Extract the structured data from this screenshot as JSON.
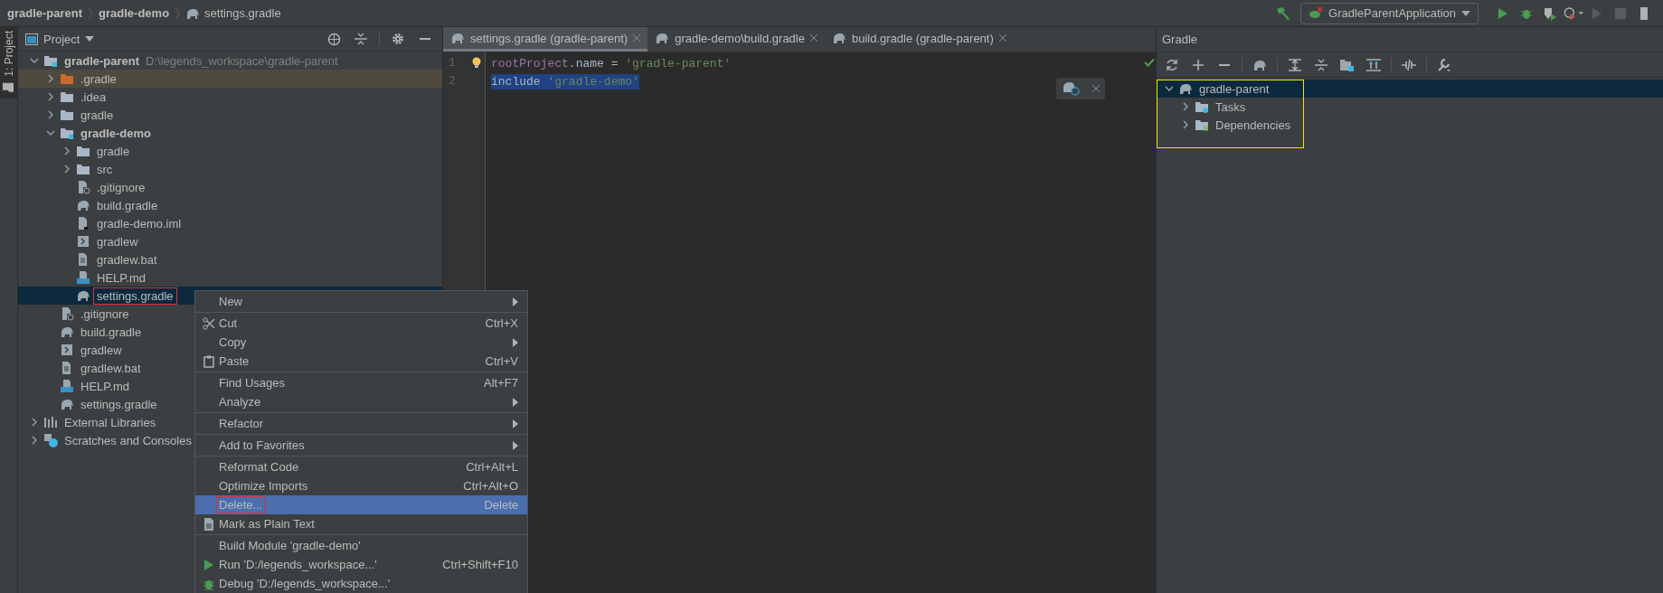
{
  "breadcrumbs": [
    {
      "label": "gradle-parent",
      "kind": "module"
    },
    {
      "label": "gradle-demo",
      "kind": "module"
    },
    {
      "label": "settings.gradle",
      "kind": "gradle"
    }
  ],
  "run_configuration": {
    "label": "GradleParentApplication"
  },
  "side_stripe": {
    "label": "1: Project",
    "selected": true
  },
  "project_panel": {
    "title": "Project",
    "tree": [
      {
        "label": "gradle-parent",
        "path": "D:\\legends_workspace\\gradle-parent",
        "kind": "module",
        "expanded": true,
        "selected": false,
        "marked": false,
        "children": [
          {
            "label": ".gradle",
            "kind": "excluded-folder",
            "expanded": false,
            "selected": false,
            "marked": false
          },
          {
            "label": ".idea",
            "kind": "folder",
            "expanded": false,
            "selected": false,
            "marked": false
          },
          {
            "label": "gradle",
            "kind": "folder",
            "expanded": false,
            "selected": false,
            "marked": false
          },
          {
            "label": "gradle-demo",
            "kind": "module",
            "expanded": true,
            "selected": false,
            "marked": false,
            "children": [
              {
                "label": "gradle",
                "kind": "folder",
                "expanded": false,
                "selected": false,
                "marked": false
              },
              {
                "label": "src",
                "kind": "folder",
                "expanded": false,
                "selected": false,
                "marked": false
              },
              {
                "label": ".gitignore",
                "kind": "ignore",
                "selected": false,
                "marked": false
              },
              {
                "label": "build.gradle",
                "kind": "gradle",
                "selected": false,
                "marked": false
              },
              {
                "label": "gradle-demo.iml",
                "kind": "iml",
                "selected": false,
                "marked": false
              },
              {
                "label": "gradlew",
                "kind": "shell",
                "selected": false,
                "marked": false
              },
              {
                "label": "gradlew.bat",
                "kind": "text",
                "selected": false,
                "marked": false
              },
              {
                "label": "HELP.md",
                "kind": "markdown",
                "selected": false,
                "marked": false
              },
              {
                "label": "settings.gradle",
                "kind": "gradle",
                "selected": true,
                "marked": true
              }
            ]
          },
          {
            "label": ".gitignore",
            "kind": "ignore",
            "selected": false,
            "marked": false
          },
          {
            "label": "build.gradle",
            "kind": "gradle",
            "selected": false,
            "marked": false
          },
          {
            "label": "gradlew",
            "kind": "shell",
            "selected": false,
            "marked": false
          },
          {
            "label": "gradlew.bat",
            "kind": "text",
            "selected": false,
            "marked": false
          },
          {
            "label": "HELP.md",
            "kind": "markdown",
            "selected": false,
            "marked": false
          },
          {
            "label": "settings.gradle",
            "kind": "gradle",
            "selected": false,
            "marked": false
          }
        ]
      },
      {
        "label": "External Libraries",
        "kind": "libraries",
        "expanded": false,
        "selected": false,
        "marked": false
      },
      {
        "label": "Scratches and Consoles",
        "kind": "scratches",
        "expanded": false,
        "selected": false,
        "marked": false
      }
    ]
  },
  "editor": {
    "tabs": [
      {
        "label": "settings.gradle (gradle-parent)",
        "selected": true
      },
      {
        "label": "gradle-demo\\build.gradle",
        "selected": false
      },
      {
        "label": "build.gradle (gradle-parent)",
        "selected": false
      }
    ],
    "lines": [
      {
        "number": "1",
        "selected": false,
        "tokens": [
          {
            "text": "rootProject",
            "kind": "ident"
          },
          {
            "text": ".name = ",
            "kind": "plain"
          },
          {
            "text": "'gradle-parent'",
            "kind": "string"
          }
        ]
      },
      {
        "number": "2",
        "selected": true,
        "tokens": [
          {
            "text": "include ",
            "kind": "plain"
          },
          {
            "text": "'gradle-demo'",
            "kind": "string"
          }
        ]
      }
    ]
  },
  "context_menu": {
    "groups": [
      [
        {
          "label": "New",
          "kind": "plain",
          "submenu": true,
          "selected": false,
          "marked": false
        }
      ],
      [
        {
          "label": "Cut",
          "kind": "cut",
          "shortcut": "Ctrl+X",
          "submenu": false,
          "selected": false,
          "marked": false
        },
        {
          "label": "Copy",
          "kind": "plain",
          "submenu": true,
          "selected": false,
          "marked": false
        },
        {
          "label": "Paste",
          "kind": "paste",
          "shortcut": "Ctrl+V",
          "submenu": false,
          "selected": false,
          "marked": false
        }
      ],
      [
        {
          "label": "Find Usages",
          "kind": "plain",
          "shortcut": "Alt+F7",
          "submenu": false,
          "selected": false,
          "marked": false
        },
        {
          "label": "Analyze",
          "kind": "plain",
          "submenu": true,
          "selected": false,
          "marked": false
        }
      ],
      [
        {
          "label": "Refactor",
          "kind": "plain",
          "submenu": true,
          "selected": false,
          "marked": false
        }
      ],
      [
        {
          "label": "Add to Favorites",
          "kind": "plain",
          "submenu": true,
          "selected": false,
          "marked": false
        }
      ],
      [
        {
          "label": "Reformat Code",
          "kind": "plain",
          "shortcut": "Ctrl+Alt+L",
          "submenu": false,
          "selected": false,
          "marked": false
        },
        {
          "label": "Optimize Imports",
          "kind": "plain",
          "shortcut": "Ctrl+Alt+O",
          "submenu": false,
          "selected": false,
          "marked": false
        },
        {
          "label": "Delete...",
          "kind": "plain",
          "shortcut": "Delete",
          "submenu": false,
          "selected": true,
          "marked": true
        },
        {
          "label": "Mark as Plain Text",
          "kind": "mark",
          "submenu": false,
          "selected": false,
          "marked": false
        }
      ],
      [
        {
          "label": "Build Module 'gradle-demo'",
          "kind": "plain",
          "submenu": false,
          "selected": false,
          "marked": false
        },
        {
          "label": "Run 'D:/legends_workspace...'",
          "kind": "run",
          "shortcut": "Ctrl+Shift+F10",
          "submenu": false,
          "selected": false,
          "marked": false
        },
        {
          "label": "Debug 'D:/legends_workspace...'",
          "kind": "debug",
          "submenu": false,
          "selected": false,
          "marked": false
        }
      ]
    ]
  },
  "gradle_panel": {
    "title": "Gradle",
    "marked": true,
    "tree": [
      {
        "label": "gradle-parent",
        "kind": "project",
        "expanded": true,
        "selected": true,
        "children": [
          {
            "label": "Tasks",
            "kind": "tasks",
            "expanded": false,
            "selected": false
          },
          {
            "label": "Dependencies",
            "kind": "dependencies",
            "expanded": false,
            "selected": false
          }
        ]
      }
    ]
  }
}
